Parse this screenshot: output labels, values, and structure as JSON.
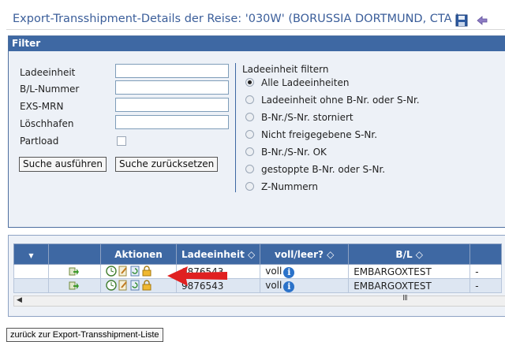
{
  "title": "Export-Transshipment-Details der Reise: '030W' (BORUSSIA DORTMUND, CTA )",
  "title_icons": [
    "save-icon",
    "back-icon"
  ],
  "filter": {
    "header": "Filter",
    "fields": [
      {
        "label": "Ladeeinheit",
        "value": ""
      },
      {
        "label": "B/L-Nummer",
        "value": ""
      },
      {
        "label": "EXS-MRN",
        "value": ""
      },
      {
        "label": "Löschhafen",
        "value": ""
      }
    ],
    "partload_label": "Partload",
    "partload_checked": false,
    "search_button": "Suche ausführen",
    "reset_button": "Suche zurücksetzen",
    "radio_group_title": "Ladeeinheit filtern",
    "radio_options": [
      "Alle Ladeeinheiten",
      "Ladeeinheit ohne B-Nr. oder S-Nr.",
      "B-Nr./S-Nr. storniert",
      "Nicht freigegebene S-Nr.",
      "B-Nr./S-Nr. OK",
      "gestoppte B-Nr. oder S-Nr.",
      "Z-Nummern"
    ],
    "radio_selected": "Alle Ladeeinheiten"
  },
  "grid": {
    "columns": [
      "",
      "",
      "Aktionen",
      "Ladeeinheit ◇",
      "voll/leer? ◇",
      "B/L ◇",
      ""
    ],
    "rows": [
      {
        "ladeeinheit": "9876543",
        "voll_leer": "voll",
        "bl": "EMBARGOXTEST",
        "last": "-"
      },
      {
        "ladeeinheit": "9876543",
        "voll_leer": "voll",
        "bl": "EMBARGOXTEST",
        "last": "-"
      }
    ],
    "scroll_grip": "III"
  },
  "back_button": "zurück zur Export-Transshipment-Liste",
  "colors": {
    "accent": "#3e68a3",
    "title": "#3b5e9a",
    "panel": "#edf1f7",
    "annotation_arrow": "#e02020"
  }
}
